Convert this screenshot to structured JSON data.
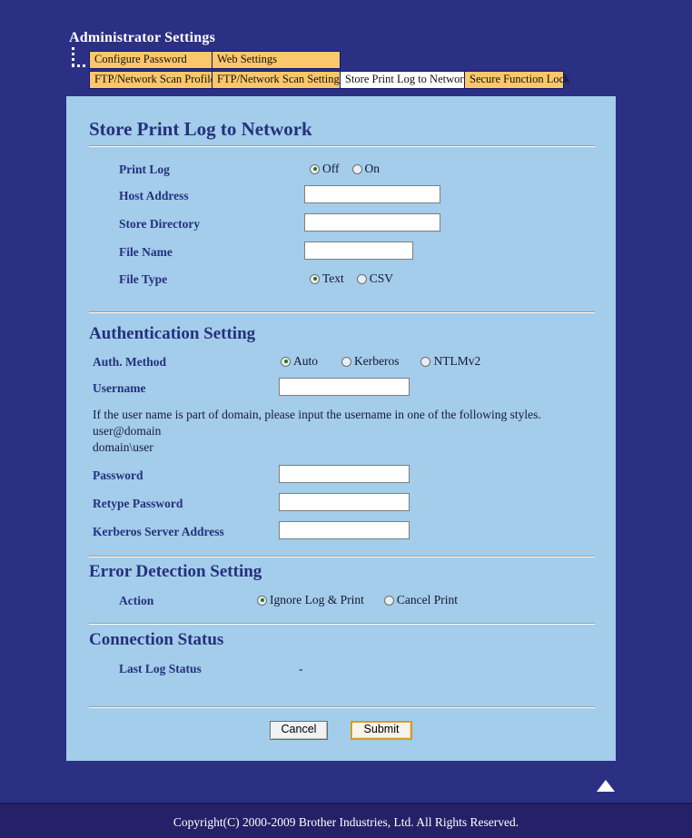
{
  "header": {
    "title": "Administrator Settings"
  },
  "tabs": {
    "row1": [
      {
        "label": "Configure Password",
        "active": false
      },
      {
        "label": "Web Settings",
        "active": false
      }
    ],
    "row2": [
      {
        "label": "FTP/Network Scan Profile",
        "active": false
      },
      {
        "label": "FTP/Network Scan Settings",
        "active": false
      },
      {
        "label": "Store Print Log to Network",
        "active": true
      },
      {
        "label": "Secure Function Lock",
        "active": false
      }
    ]
  },
  "main": {
    "page_heading": "Store Print Log to Network",
    "print_log": {
      "label": "Print Log",
      "options": [
        {
          "label": "Off",
          "selected": true
        },
        {
          "label": "On",
          "selected": false
        }
      ]
    },
    "host_address": {
      "label": "Host Address",
      "value": "",
      "placeholder": ""
    },
    "store_directory": {
      "label": "Store Directory",
      "value": "",
      "placeholder": ""
    },
    "file_name": {
      "label": "File Name",
      "value": "",
      "placeholder": ""
    },
    "file_type": {
      "label": "File Type",
      "options": [
        {
          "label": "Text",
          "selected": true
        },
        {
          "label": "CSV",
          "selected": false
        }
      ]
    },
    "authentication": {
      "heading": "Authentication Setting",
      "auth_method": {
        "label": "Auth. Method",
        "options": [
          {
            "label": "Auto",
            "selected": true
          },
          {
            "label": "Kerberos",
            "selected": false
          },
          {
            "label": "NTLMv2",
            "selected": false
          }
        ]
      },
      "username": {
        "label": "Username",
        "value": "",
        "placeholder": ""
      },
      "hint_line1": "If the user name is part of domain, please input the username in one of the following styles.",
      "hint_line2": "user@domain",
      "hint_line3": "domain\\user",
      "password": {
        "label": "Password",
        "value": "",
        "placeholder": ""
      },
      "retype_password": {
        "label": "Retype Password",
        "value": "",
        "placeholder": ""
      },
      "kerberos_server_address": {
        "label": "Kerberos Server Address",
        "value": "",
        "placeholder": ""
      }
    },
    "error_detection": {
      "heading": "Error Detection Setting",
      "action": {
        "label": "Action",
        "options": [
          {
            "label": "Ignore Log & Print",
            "selected": true
          },
          {
            "label": "Cancel Print",
            "selected": false
          }
        ]
      }
    },
    "connection_status": {
      "heading": "Connection Status",
      "last_log_status": {
        "label": "Last Log Status",
        "value": "-"
      }
    },
    "buttons": {
      "cancel": "Cancel",
      "submit": "Submit"
    }
  },
  "footer": {
    "back_to_top_icon": "triangle-up-icon",
    "copyright": "Copyright(C) 2000-2009 Brother Industries, Ltd. All Rights Reserved."
  },
  "colors": {
    "page_background": "#2b3084",
    "footer_background": "#252168",
    "card_background": "#a3cdea",
    "tab_inactive": "#fcc76a",
    "tab_active": "#ffffff",
    "heading_blue": "#26307e",
    "radio_selected_dot": "#1a7d1a",
    "submit_border": "#d99b23"
  }
}
